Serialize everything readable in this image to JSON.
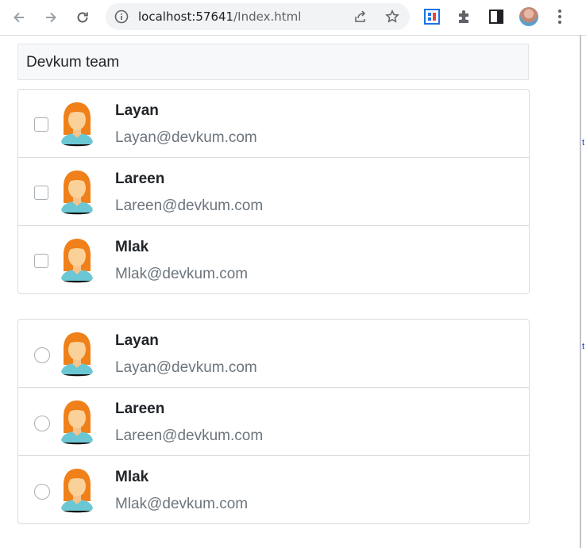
{
  "browser": {
    "url_host": "localhost:57641",
    "url_path": "/Index.html"
  },
  "team": {
    "title": "Devkum team"
  },
  "checkbox_list": [
    {
      "name": "Layan",
      "email": "Layan@devkum.com",
      "checked": false
    },
    {
      "name": "Lareen",
      "email": "Lareen@devkum.com",
      "checked": false
    },
    {
      "name": "Mlak",
      "email": "Mlak@devkum.com",
      "checked": false
    }
  ],
  "radio_list": [
    {
      "name": "Layan",
      "email": "Layan@devkum.com",
      "selected": false
    },
    {
      "name": "Lareen",
      "email": "Lareen@devkum.com",
      "selected": false
    },
    {
      "name": "Mlak",
      "email": "Mlak@devkum.com",
      "selected": false
    }
  ],
  "icons": {
    "back": "back-arrow-icon",
    "forward": "forward-arrow-icon",
    "reload": "reload-icon",
    "site_info": "info-icon",
    "share": "share-icon",
    "bookmark": "star-icon",
    "extension_1": "extension-app-icon",
    "extensions": "puzzle-icon",
    "side_panel": "side-panel-icon",
    "profile": "profile-avatar",
    "menu": "more-vert-icon",
    "person": "female-avatar-icon"
  },
  "colors": {
    "hair": "#f08019",
    "skin": "#fbd19a",
    "shirt": "#6cc7d4",
    "text_muted": "#6c757d",
    "accent_extension": "#1a73e8"
  }
}
